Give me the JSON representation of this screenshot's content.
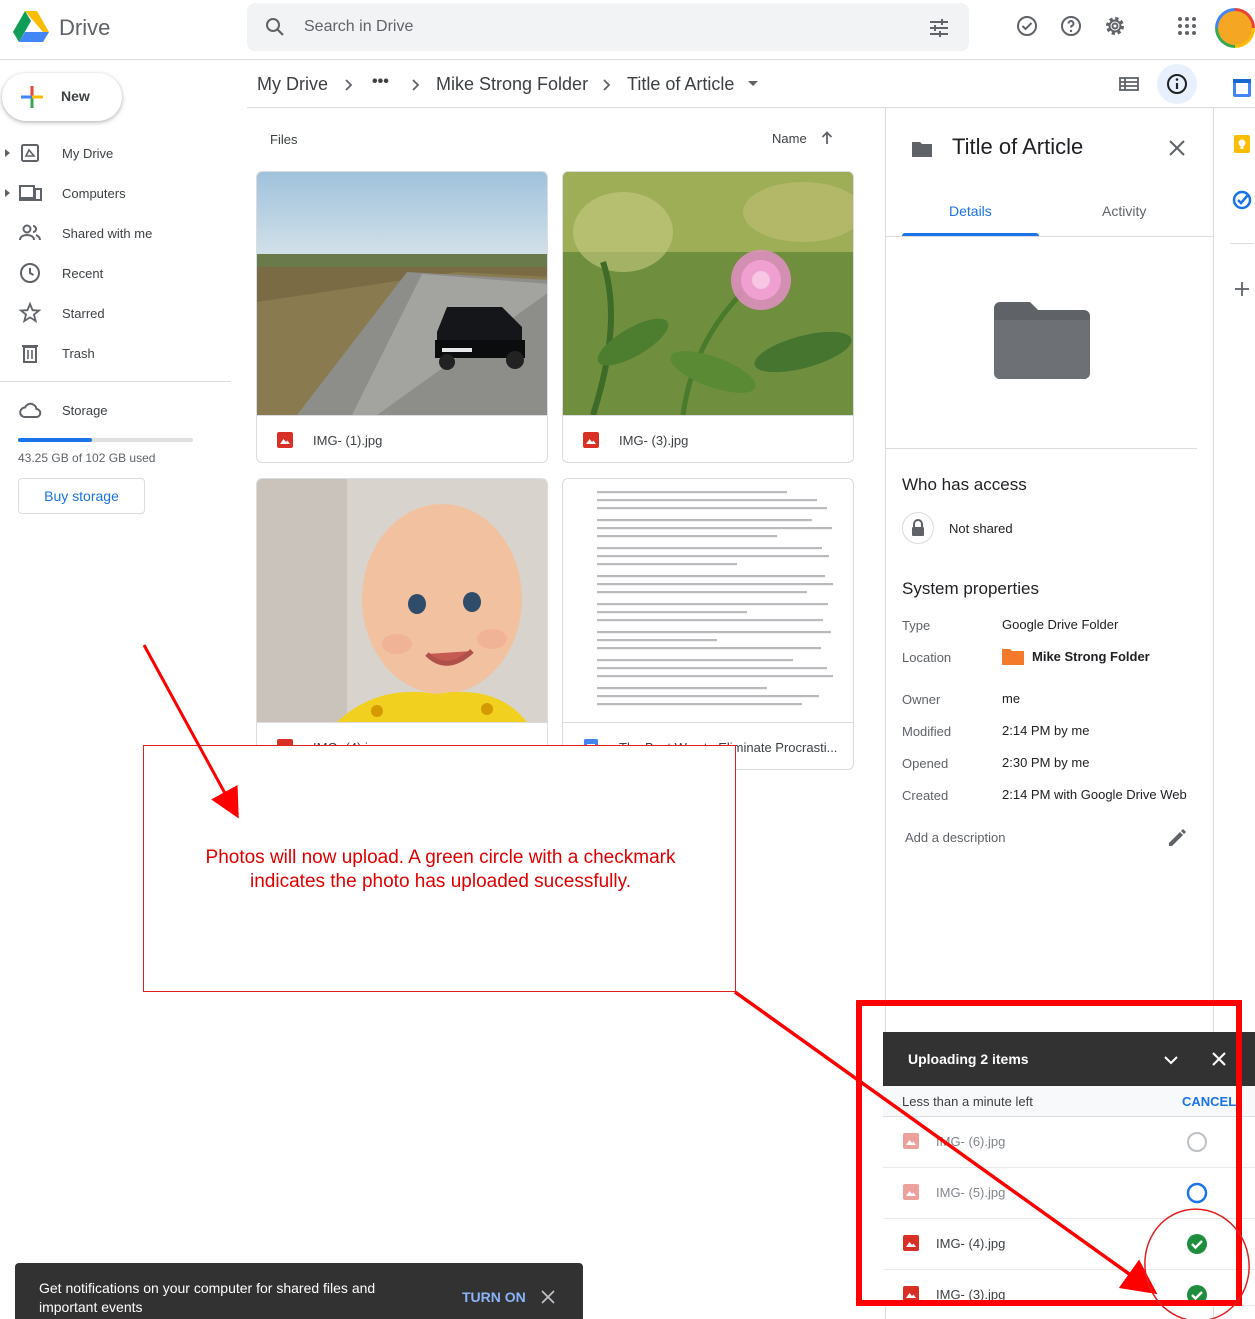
{
  "app": {
    "name": "Drive"
  },
  "search": {
    "placeholder": "Search in Drive"
  },
  "nav": {
    "new_label": "New",
    "items": [
      {
        "label": "My Drive",
        "icon": "drive-icon"
      },
      {
        "label": "Computers",
        "icon": "computer-icon"
      },
      {
        "label": "Shared with me",
        "icon": "people-icon"
      },
      {
        "label": "Recent",
        "icon": "clock-icon"
      },
      {
        "label": "Starred",
        "icon": "star-icon"
      },
      {
        "label": "Trash",
        "icon": "trash-icon"
      }
    ],
    "storage_label": "Storage",
    "storage_used": "43.25 GB of 102 GB used",
    "storage_fraction": 0.42,
    "buy_storage": "Buy storage"
  },
  "breadcrumb": {
    "root": "My Drive",
    "more": "•••",
    "folder": "Mike Strong Folder",
    "current": "Title of Article"
  },
  "files": {
    "section_label": "Files",
    "sort_label": "Name",
    "items": [
      {
        "name": "IMG- (1).jpg",
        "type": "image"
      },
      {
        "name": "IMG- (3).jpg",
        "type": "image"
      },
      {
        "name": "IMG- (4).jpg",
        "type": "image"
      },
      {
        "name": "The Best Way to Eliminate Procrasti...",
        "type": "doc"
      }
    ]
  },
  "details": {
    "title": "Title of Article",
    "tabs": [
      "Details",
      "Activity"
    ],
    "who_has_access": "Who has access",
    "access_value": "Not shared",
    "system_properties": "System properties",
    "props": [
      {
        "label": "Type",
        "value": "Google Drive Folder"
      },
      {
        "label": "Location",
        "value": "Mike Strong Folder"
      },
      {
        "label": "Owner",
        "value": "me"
      },
      {
        "label": "Modified",
        "value": "2:14 PM by me"
      },
      {
        "label": "Opened",
        "value": "2:30 PM by me"
      },
      {
        "label": "Created",
        "value": "2:14 PM with Google Drive Web"
      }
    ],
    "add_description": "Add a description"
  },
  "annotation": {
    "text_line1": "Photos will now upload. A green circle with a checkmark",
    "text_line2": "indicates the photo has uploaded sucessfully."
  },
  "upload": {
    "title": "Uploading 2 items",
    "status": "Less than a minute left",
    "cancel": "CANCEL",
    "items": [
      {
        "name": "IMG- (6).jpg",
        "state": "pending"
      },
      {
        "name": "IMG- (5).jpg",
        "state": "uploading"
      },
      {
        "name": "IMG- (4).jpg",
        "state": "done"
      },
      {
        "name": "IMG- (3).jpg",
        "state": "done"
      }
    ]
  },
  "snackbar": {
    "text": "Get notifications on your computer for shared files and important events",
    "action": "TURN ON"
  },
  "colors": {
    "accent": "#1a73e8",
    "annotation_red": "#e00000",
    "success_green": "#1e8e3e",
    "folder_orange": "#f4792b"
  }
}
